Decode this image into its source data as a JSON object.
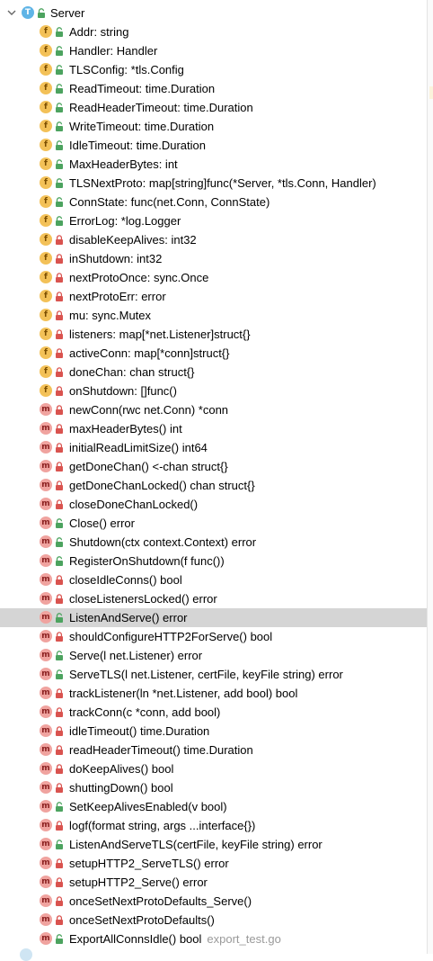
{
  "root": {
    "label": "Server",
    "icon": "type-icon",
    "badge": "T",
    "expanded": true,
    "visibility": "public"
  },
  "badges": {
    "field": "f",
    "method": "m"
  },
  "colors": {
    "field_badge": "#f3c158",
    "method_badge": "#f0a39f",
    "type_badge": "#5fb4e6",
    "public": "#4ca35f",
    "private": "#d9534f",
    "selected_row": "#d5d5d5"
  },
  "members": [
    {
      "kind": "field",
      "visibility": "public",
      "label": "Addr: string"
    },
    {
      "kind": "field",
      "visibility": "public",
      "label": "Handler: Handler"
    },
    {
      "kind": "field",
      "visibility": "public",
      "label": "TLSConfig: *tls.Config"
    },
    {
      "kind": "field",
      "visibility": "public",
      "label": "ReadTimeout: time.Duration"
    },
    {
      "kind": "field",
      "visibility": "public",
      "label": "ReadHeaderTimeout: time.Duration"
    },
    {
      "kind": "field",
      "visibility": "public",
      "label": "WriteTimeout: time.Duration"
    },
    {
      "kind": "field",
      "visibility": "public",
      "label": "IdleTimeout: time.Duration"
    },
    {
      "kind": "field",
      "visibility": "public",
      "label": "MaxHeaderBytes: int"
    },
    {
      "kind": "field",
      "visibility": "public",
      "label": "TLSNextProto: map[string]func(*Server, *tls.Conn, Handler)"
    },
    {
      "kind": "field",
      "visibility": "public",
      "label": "ConnState: func(net.Conn, ConnState)"
    },
    {
      "kind": "field",
      "visibility": "public",
      "label": "ErrorLog: *log.Logger"
    },
    {
      "kind": "field",
      "visibility": "private",
      "label": "disableKeepAlives: int32"
    },
    {
      "kind": "field",
      "visibility": "private",
      "label": "inShutdown: int32"
    },
    {
      "kind": "field",
      "visibility": "private",
      "label": "nextProtoOnce: sync.Once"
    },
    {
      "kind": "field",
      "visibility": "private",
      "label": "nextProtoErr: error"
    },
    {
      "kind": "field",
      "visibility": "private",
      "label": "mu: sync.Mutex"
    },
    {
      "kind": "field",
      "visibility": "private",
      "label": "listeners: map[*net.Listener]struct{}"
    },
    {
      "kind": "field",
      "visibility": "private",
      "label": "activeConn: map[*conn]struct{}"
    },
    {
      "kind": "field",
      "visibility": "private",
      "label": "doneChan: chan struct{}"
    },
    {
      "kind": "field",
      "visibility": "private",
      "label": "onShutdown: []func()"
    },
    {
      "kind": "method",
      "visibility": "private",
      "label": "newConn(rwc net.Conn) *conn"
    },
    {
      "kind": "method",
      "visibility": "private",
      "label": "maxHeaderBytes() int"
    },
    {
      "kind": "method",
      "visibility": "private",
      "label": "initialReadLimitSize() int64"
    },
    {
      "kind": "method",
      "visibility": "private",
      "label": "getDoneChan() <-chan struct{}"
    },
    {
      "kind": "method",
      "visibility": "private",
      "label": "getDoneChanLocked() chan struct{}"
    },
    {
      "kind": "method",
      "visibility": "private",
      "label": "closeDoneChanLocked()"
    },
    {
      "kind": "method",
      "visibility": "public",
      "label": "Close() error"
    },
    {
      "kind": "method",
      "visibility": "public",
      "label": "Shutdown(ctx context.Context) error"
    },
    {
      "kind": "method",
      "visibility": "public",
      "label": "RegisterOnShutdown(f func())"
    },
    {
      "kind": "method",
      "visibility": "private",
      "label": "closeIdleConns() bool"
    },
    {
      "kind": "method",
      "visibility": "private",
      "label": "closeListenersLocked() error"
    },
    {
      "kind": "method",
      "visibility": "public",
      "label": "ListenAndServe() error",
      "selected": true
    },
    {
      "kind": "method",
      "visibility": "private",
      "label": "shouldConfigureHTTP2ForServe() bool"
    },
    {
      "kind": "method",
      "visibility": "public",
      "label": "Serve(l net.Listener) error"
    },
    {
      "kind": "method",
      "visibility": "public",
      "label": "ServeTLS(l net.Listener, certFile, keyFile string) error"
    },
    {
      "kind": "method",
      "visibility": "private",
      "label": "trackListener(ln *net.Listener, add bool) bool"
    },
    {
      "kind": "method",
      "visibility": "private",
      "label": "trackConn(c *conn, add bool)"
    },
    {
      "kind": "method",
      "visibility": "private",
      "label": "idleTimeout() time.Duration"
    },
    {
      "kind": "method",
      "visibility": "private",
      "label": "readHeaderTimeout() time.Duration"
    },
    {
      "kind": "method",
      "visibility": "private",
      "label": "doKeepAlives() bool"
    },
    {
      "kind": "method",
      "visibility": "private",
      "label": "shuttingDown() bool"
    },
    {
      "kind": "method",
      "visibility": "public",
      "label": "SetKeepAlivesEnabled(v bool)"
    },
    {
      "kind": "method",
      "visibility": "private",
      "label": "logf(format string, args ...interface{})"
    },
    {
      "kind": "method",
      "visibility": "public",
      "label": "ListenAndServeTLS(certFile, keyFile string) error"
    },
    {
      "kind": "method",
      "visibility": "private",
      "label": "setupHTTP2_ServeTLS() error"
    },
    {
      "kind": "method",
      "visibility": "private",
      "label": "setupHTTP2_Serve() error"
    },
    {
      "kind": "method",
      "visibility": "private",
      "label": "onceSetNextProtoDefaults_Serve()"
    },
    {
      "kind": "method",
      "visibility": "private",
      "label": "onceSetNextProtoDefaults()"
    },
    {
      "kind": "method",
      "visibility": "public",
      "label": "ExportAllConnsIdle() bool",
      "hint": "export_test.go"
    }
  ]
}
